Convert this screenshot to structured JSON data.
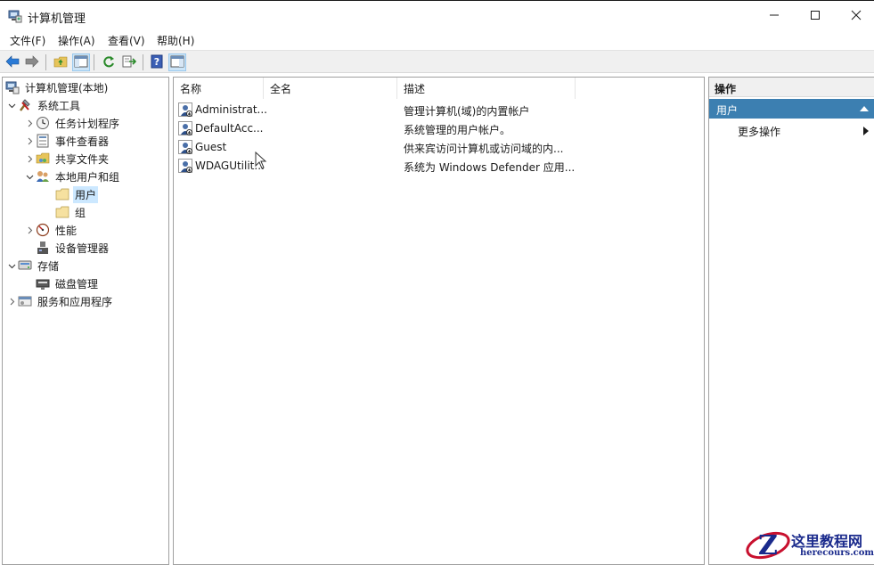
{
  "window": {
    "title": "计算机管理",
    "controls": [
      "minimize",
      "maximize",
      "close"
    ]
  },
  "menubar": {
    "items": [
      {
        "label": "文件(F)"
      },
      {
        "label": "操作(A)"
      },
      {
        "label": "查看(V)"
      },
      {
        "label": "帮助(H)"
      }
    ]
  },
  "toolbar": {
    "buttons": [
      {
        "icon": "back-arrow-icon"
      },
      {
        "icon": "forward-arrow-icon"
      },
      {
        "icon": "up-folder-icon"
      },
      {
        "icon": "show-hide-tree-icon"
      },
      {
        "icon": "refresh-icon"
      },
      {
        "icon": "export-list-icon"
      },
      {
        "icon": "help-icon"
      },
      {
        "icon": "show-hide-action-pane-icon"
      }
    ]
  },
  "tree": {
    "items": [
      {
        "label": "计算机管理(本地)",
        "level": 0,
        "expander": "",
        "icon": "computer-management-icon"
      },
      {
        "label": "系统工具",
        "level": 0,
        "expander": "expanded",
        "icon": "system-tools-icon"
      },
      {
        "label": "任务计划程序",
        "level": 1,
        "expander": "collapsed",
        "icon": "clock-icon"
      },
      {
        "label": "事件查看器",
        "level": 1,
        "expander": "collapsed",
        "icon": "event-viewer-icon"
      },
      {
        "label": "共享文件夹",
        "level": 1,
        "expander": "collapsed",
        "icon": "shared-folder-icon"
      },
      {
        "label": "本地用户和组",
        "level": 1,
        "expander": "expanded",
        "icon": "users-groups-icon"
      },
      {
        "label": "用户",
        "level": 2,
        "expander": "",
        "icon": "folder-icon",
        "selected": true
      },
      {
        "label": "组",
        "level": 2,
        "expander": "",
        "icon": "folder-icon"
      },
      {
        "label": "性能",
        "level": 1,
        "expander": "collapsed",
        "icon": "performance-icon"
      },
      {
        "label": "设备管理器",
        "level": 1,
        "expander": "",
        "icon": "device-manager-icon"
      },
      {
        "label": "存储",
        "level": 0,
        "expander": "expanded",
        "icon": "storage-icon"
      },
      {
        "label": "磁盘管理",
        "level": 1,
        "expander": "",
        "icon": "disk-management-icon"
      },
      {
        "label": "服务和应用程序",
        "level": 0,
        "expander": "collapsed",
        "icon": "services-apps-icon"
      }
    ]
  },
  "list": {
    "columns": [
      "名称",
      "全名",
      "描述"
    ],
    "rows": [
      {
        "name": "Administrat...",
        "fullname": "",
        "description": "管理计算机(域)的内置帐户",
        "icon": "user-disabled-icon"
      },
      {
        "name": "DefaultAcc...",
        "fullname": "",
        "description": "系统管理的用户帐户。",
        "icon": "user-disabled-icon"
      },
      {
        "name": "Guest",
        "fullname": "",
        "description": "供来宾访问计算机或访问域的内...",
        "icon": "user-disabled-icon"
      },
      {
        "name": "WDAGUtilit...",
        "fullname": "",
        "description": "系统为 Windows Defender 应用...",
        "icon": "user-disabled-icon"
      }
    ]
  },
  "actions": {
    "header": "操作",
    "group_label": "用户",
    "item_label": "更多操作"
  },
  "watermark": {
    "line1": "这里教程网",
    "line2": "herecours.com",
    "logo_letter": "Z"
  },
  "colors": {
    "selection": "#cce8ff",
    "action_group_bg": "#3c7fb1",
    "watermark": "#1a2a8c"
  }
}
